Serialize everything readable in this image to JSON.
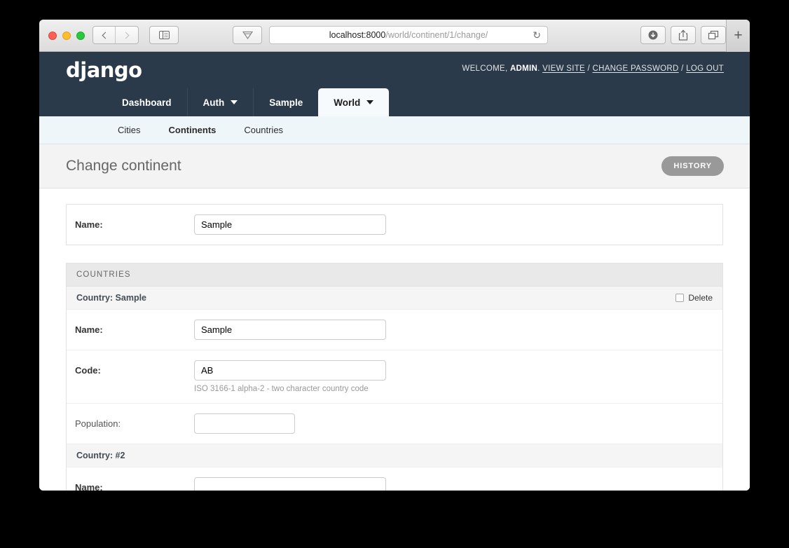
{
  "browser": {
    "url_host": "localhost:8000",
    "url_path": "/world/continent/1/change/",
    "reload_glyph": "↻",
    "plus_label": "+"
  },
  "django": {
    "logo": "django",
    "user_tools": {
      "welcome_prefix": "WELCOME, ",
      "username": "ADMIN",
      "period": ". ",
      "view_site": "VIEW SITE",
      "sep1": " / ",
      "change_password": "CHANGE PASSWORD",
      "sep2": " / ",
      "log_out": "LOG OUT"
    },
    "tabs": [
      {
        "label": "Dashboard",
        "has_caret": false,
        "active": false
      },
      {
        "label": "Auth",
        "has_caret": true,
        "active": false
      },
      {
        "label": "Sample",
        "has_caret": false,
        "active": false
      },
      {
        "label": "World",
        "has_caret": true,
        "active": true
      }
    ],
    "subnav": [
      {
        "label": "Cities",
        "active": false
      },
      {
        "label": "Continents",
        "active": true
      },
      {
        "label": "Countries",
        "active": false
      }
    ],
    "page_title": "Change continent",
    "history_button": "HISTORY",
    "main_form": {
      "name_label": "Name:",
      "name_value": "Sample"
    },
    "inline_group": {
      "title": "COUNTRIES",
      "items": [
        {
          "heading": "Country: Sample",
          "delete_label": "Delete",
          "delete_checked": false,
          "fields": [
            {
              "label": "Name:",
              "value": "Sample",
              "required": true,
              "help": "",
              "width": "wide"
            },
            {
              "label": "Code:",
              "value": "AB",
              "required": true,
              "help": "ISO 3166-1 alpha-2 - two character country code",
              "width": "wide"
            },
            {
              "label": "Population:",
              "value": "",
              "required": false,
              "help": "",
              "width": "narrow"
            }
          ]
        },
        {
          "heading": "Country: #2",
          "delete_label": "",
          "delete_checked": false,
          "fields": [
            {
              "label": "Name:",
              "value": "",
              "required": true,
              "help": "",
              "width": "wide"
            }
          ]
        }
      ]
    }
  },
  "colors": {
    "header_navy": "#2b3a4a",
    "subnav_blue": "#eff6fa",
    "history_gray": "#999999"
  }
}
